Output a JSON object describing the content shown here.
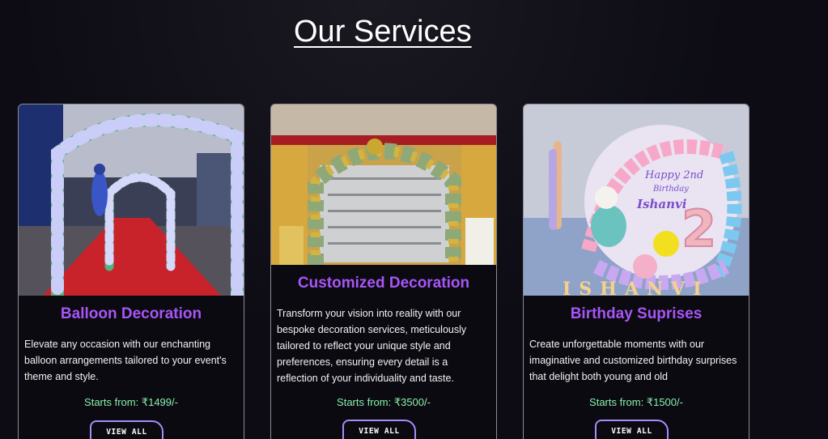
{
  "section": {
    "title": "Our Services"
  },
  "cards": [
    {
      "title": "Balloon Decoration",
      "description": "Elevate any occasion with our enchanting balloon arrangements tailored to your event's theme and style.",
      "price": "Starts from: ₹1499/-",
      "button": "VIEW ALL",
      "image_alt": "Balloon arch entrance with red carpet"
    },
    {
      "title": "Customized Decoration",
      "description": "Transform your vision into reality with our bespoke decoration services, meticulously tailored to reflect your unique style and preferences, ensuring every detail is a reflection of your individuality and taste.",
      "price": "Starts from: ₹3500/-",
      "button": "VIEW ALL",
      "image_alt": "Sequin backdrop framed by green and gold balloons"
    },
    {
      "title": "Birthday Suprises",
      "description": "Create unforgettable moments with our imaginative and customized birthday surprises that delight both young and old",
      "price": "Starts from: ₹1500/-",
      "button": "VIEW ALL",
      "image_alt": "Pastel balloon birthday setup with unicorn",
      "image_text": {
        "line1": "Happy 2nd",
        "line2": "Birthday",
        "line3": "Ishanvi",
        "number": "2",
        "marquee": "ISHANVI"
      }
    }
  ],
  "colors": {
    "background": "#0d0c14",
    "accent_title": "#a855f7",
    "price": "#86efac",
    "button_border": "#a78bfa"
  }
}
